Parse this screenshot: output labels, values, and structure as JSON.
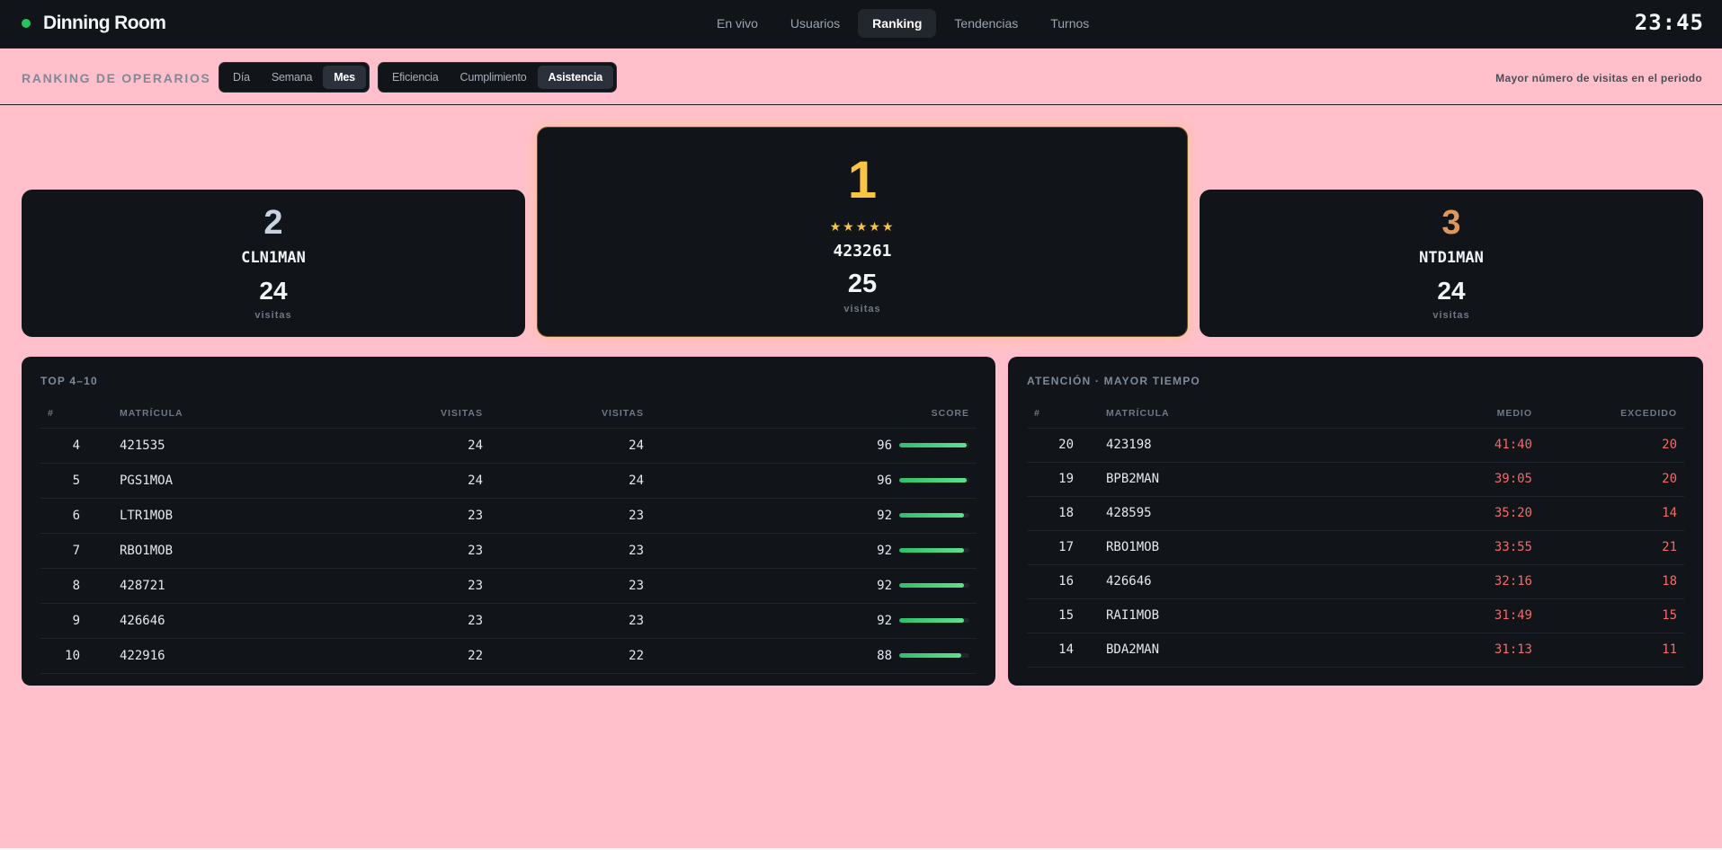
{
  "app": {
    "title": "Dinning Room",
    "clock": "23:45"
  },
  "nav": [
    {
      "label": "En vivo",
      "active": false
    },
    {
      "label": "Usuarios",
      "active": false
    },
    {
      "label": "Ranking",
      "active": true
    },
    {
      "label": "Tendencias",
      "active": false
    },
    {
      "label": "Turnos",
      "active": false
    }
  ],
  "subheader": {
    "title": "RANKING DE OPERARIOS",
    "period_options": [
      {
        "label": "Día",
        "active": false
      },
      {
        "label": "Semana",
        "active": false
      },
      {
        "label": "Mes",
        "active": true
      }
    ],
    "metric_options": [
      {
        "label": "Eficiencia",
        "active": false
      },
      {
        "label": "Cumplimiento",
        "active": false
      },
      {
        "label": "Asistencia",
        "active": true
      }
    ],
    "hint": "Mayor número de visitas en el periodo"
  },
  "podium": {
    "first": {
      "rank": "1",
      "stars": "★★★★★",
      "name": "423261",
      "count": "25",
      "unit": "visitas"
    },
    "second": {
      "rank": "2",
      "name": "CLN1MAN",
      "count": "24",
      "unit": "visitas"
    },
    "third": {
      "rank": "3",
      "name": "NTD1MAN",
      "count": "24",
      "unit": "visitas"
    }
  },
  "top_table": {
    "title": "TOP 4–10",
    "headers": [
      "#",
      "MATRÍCULA",
      "VISITAS",
      "VISITAS",
      "SCORE"
    ],
    "rows": [
      {
        "rank": "4",
        "id": "421535",
        "v1": "24",
        "v2": "24",
        "score": 96
      },
      {
        "rank": "5",
        "id": "PGS1MOA",
        "v1": "24",
        "v2": "24",
        "score": 96
      },
      {
        "rank": "6",
        "id": "LTR1MOB",
        "v1": "23",
        "v2": "23",
        "score": 92
      },
      {
        "rank": "7",
        "id": "RBO1MOB",
        "v1": "23",
        "v2": "23",
        "score": 92
      },
      {
        "rank": "8",
        "id": "428721",
        "v1": "23",
        "v2": "23",
        "score": 92
      },
      {
        "rank": "9",
        "id": "426646",
        "v1": "23",
        "v2": "23",
        "score": 92
      },
      {
        "rank": "10",
        "id": "422916",
        "v1": "22",
        "v2": "22",
        "score": 88
      }
    ]
  },
  "attention_table": {
    "title": "ATENCIÓN · MAYOR TIEMPO",
    "headers": [
      "#",
      "MATRÍCULA",
      "MEDIO",
      "EXCEDIDO"
    ],
    "rows": [
      {
        "rank": "20",
        "id": "423198",
        "avg": "41:40",
        "exceeded": "20"
      },
      {
        "rank": "19",
        "id": "BPB2MAN",
        "avg": "39:05",
        "exceeded": "20"
      },
      {
        "rank": "18",
        "id": "428595",
        "avg": "35:20",
        "exceeded": "14"
      },
      {
        "rank": "17",
        "id": "RBO1MOB",
        "avg": "33:55",
        "exceeded": "21"
      },
      {
        "rank": "16",
        "id": "426646",
        "avg": "32:16",
        "exceeded": "18"
      },
      {
        "rank": "15",
        "id": "RAI1MOB",
        "avg": "31:49",
        "exceeded": "15"
      },
      {
        "rank": "14",
        "id": "BDA2MAN",
        "avg": "31:13",
        "exceeded": "11"
      }
    ]
  },
  "colors": {
    "background": "#ffc0cb",
    "panel": "#111418",
    "gold": "#f7c443",
    "silver": "#c9d3e0",
    "bronze": "#dd965e",
    "alert": "#f36a6a",
    "score_bar": "#4ade80",
    "live": "#22c55e"
  }
}
